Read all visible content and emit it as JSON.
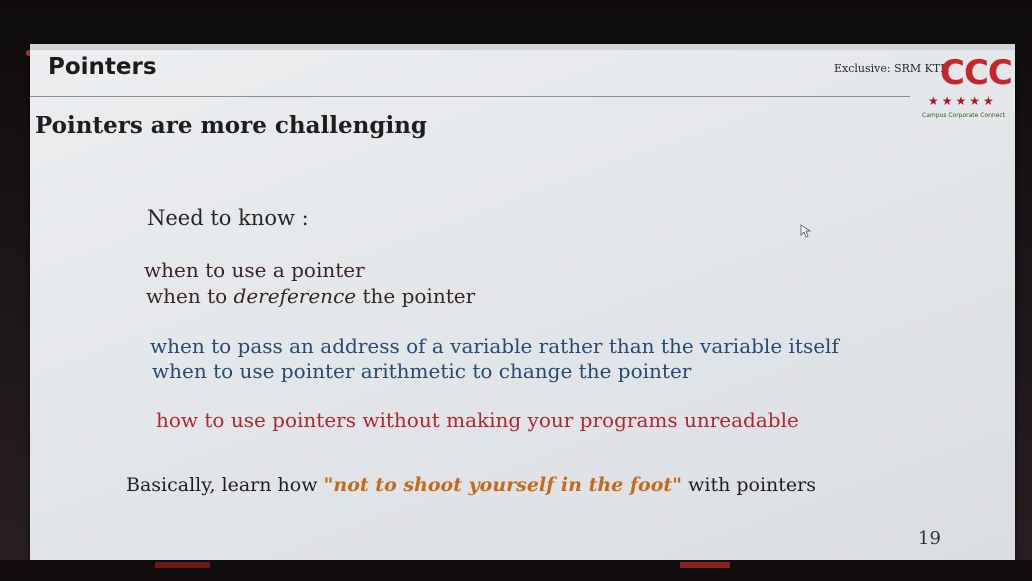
{
  "slide": {
    "title": "Pointers",
    "exclusive": "Exclusive: SRM KTR",
    "logo": {
      "letters": "CCC",
      "stars": "★★★★★",
      "tagline": "Campus Corporate Connect"
    },
    "subtitle": "Pointers are more challenging",
    "need_to_know": "Need to know :",
    "group1": [
      {
        "pre": "when to use a pointer",
        "em": "",
        "post": ""
      },
      {
        "pre": "when to ",
        "em": "dereference",
        "post": " the pointer"
      }
    ],
    "group2": [
      "when to pass an address of a variable rather than the variable itself",
      "when to use pointer arithmetic to change the pointer"
    ],
    "group3": [
      "how to use pointers without making your programs unreadable"
    ],
    "basically": {
      "pre": "Basically, learn how ",
      "quote": "\"not to shoot yourself in the foot\"",
      "post": " with pointers"
    },
    "page_number": "19"
  },
  "colors": {
    "title": "#1b1b1b",
    "group1": "#3a2526",
    "group2": "#244a78",
    "group3": "#b3272b",
    "quote": "#c46a1a",
    "logo": "#c8242a"
  },
  "icons": {
    "cursor": "mouse-pointer-icon"
  }
}
